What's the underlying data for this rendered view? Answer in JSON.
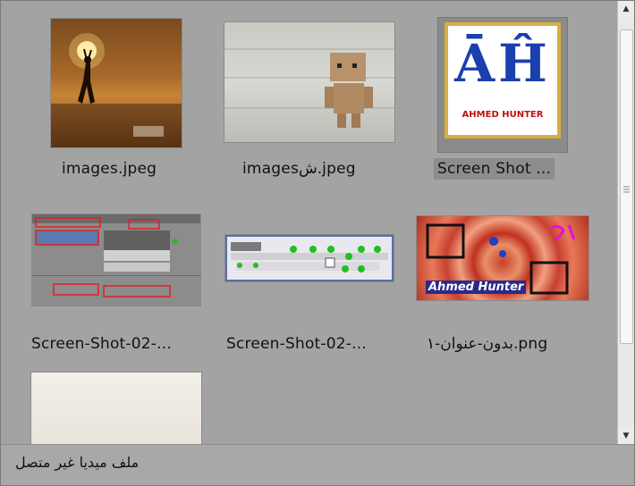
{
  "files": [
    {
      "name": "images.jpeg",
      "selected": false
    },
    {
      "name": "imagesش.jpeg",
      "selected": false
    },
    {
      "name": "Screen Shot ...",
      "selected": true
    },
    {
      "name": "Screen-Shot-02-...",
      "selected": false
    },
    {
      "name": "Screen-Shot-02-...",
      "selected": false
    },
    {
      "name": "بدون-عنوان-١.png",
      "selected": false
    },
    {
      "name": "",
      "selected": false
    }
  ],
  "thumbs": {
    "ah_logo_text": "ĀĤ",
    "ah_caption": "AHMED HUNTER",
    "banner_text": "Ahmed Hunter"
  },
  "status": {
    "text": "ملف ميديا غير متصل"
  },
  "colors": {
    "panel_bg": "#a3a3a3",
    "selection_bg": "#8d8d8d",
    "scrollbar_bg": "#e9e9e9"
  }
}
